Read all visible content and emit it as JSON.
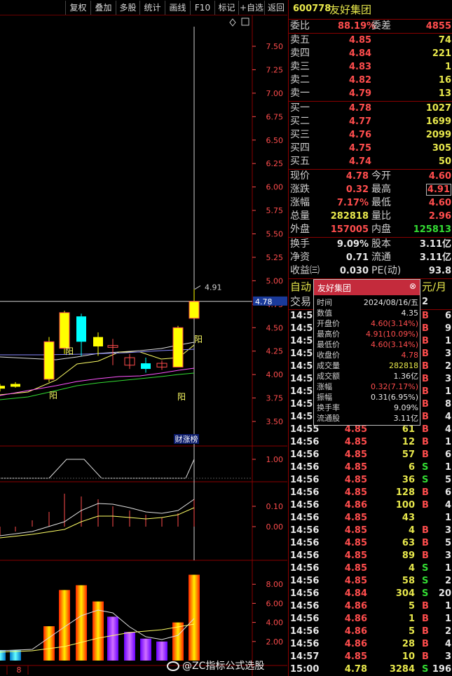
{
  "toolbar": {
    "items": [
      "复权",
      "叠加",
      "多股",
      "统计",
      "画线",
      "F10",
      "标记",
      "+自选",
      "返回"
    ]
  },
  "chart": {
    "price_axis": [
      "7.50",
      "7.25",
      "7.00",
      "6.75",
      "6.50",
      "6.25",
      "6.00",
      "5.75",
      "5.50",
      "5.25",
      "5.00",
      "4.75",
      "4.50",
      "4.25",
      "4.00",
      "3.75",
      "3.50"
    ],
    "current_price_tag": "4.78",
    "peak_label": "4.91",
    "yang_labels": [
      "阳",
      "阳",
      "阳",
      "阳"
    ],
    "event_label": "财涨榜",
    "ind1_axis": [
      "1.00"
    ],
    "ind2_axis": [
      "0.10",
      "0.00"
    ],
    "vol_axis": [
      "8.00",
      "6.00",
      "4.00",
      "2.00"
    ],
    "bottom_label": "8",
    "colors": {
      "up": "#ffff00",
      "down": "#00ffff",
      "red": "#ff3333",
      "purple": "#8a2be2",
      "axis": "#ff4d4d"
    },
    "chart_data": {
      "type": "candlestick",
      "candles": [
        {
          "o": 3.85,
          "c": 3.88,
          "h": 3.9,
          "l": 3.82
        },
        {
          "o": 3.87,
          "c": 3.9,
          "h": 3.92,
          "l": 3.86
        },
        {
          "o": 3.95,
          "c": 4.35,
          "h": 4.4,
          "l": 3.92
        },
        {
          "o": 4.28,
          "c": 4.66,
          "h": 4.68,
          "l": 4.22
        },
        {
          "o": 4.62,
          "c": 4.35,
          "h": 4.65,
          "l": 4.2
        },
        {
          "o": 4.3,
          "c": 4.4,
          "h": 4.45,
          "l": 4.2
        },
        {
          "o": 4.31,
          "c": 4.29,
          "h": 4.38,
          "l": 4.1
        },
        {
          "o": 4.18,
          "c": 4.1,
          "h": 4.22,
          "l": 4.06
        },
        {
          "o": 4.12,
          "c": 4.06,
          "h": 4.18,
          "l": 4.02
        },
        {
          "o": 4.12,
          "c": 4.08,
          "h": 4.15,
          "l": 4.05
        },
        {
          "o": 4.08,
          "c": 4.5,
          "h": 4.52,
          "l": 4.08
        },
        {
          "o": 4.6,
          "c": 4.78,
          "h": 4.91,
          "l": 4.6
        }
      ],
      "volume": [
        1.1,
        1.1,
        3.6,
        7.4,
        7.9,
        6.2,
        4.6,
        3.0,
        2.3,
        2.0,
        4.0,
        9.0
      ],
      "vol_ylim": [
        0,
        10
      ],
      "price_ylim": [
        3.4,
        7.7
      ]
    }
  },
  "quote": {
    "code": "600778",
    "name": "友好集团",
    "weibi_label": "委比",
    "weibi_value": "88.19%",
    "weicha_label": "委差",
    "weicha_value": "4855",
    "asks": [
      {
        "label": "卖五",
        "price": "4.85",
        "vol": "74"
      },
      {
        "label": "卖四",
        "price": "4.84",
        "vol": "221"
      },
      {
        "label": "卖三",
        "price": "4.83",
        "vol": "1"
      },
      {
        "label": "卖二",
        "price": "4.82",
        "vol": "16"
      },
      {
        "label": "卖一",
        "price": "4.79",
        "vol": "13"
      }
    ],
    "bids": [
      {
        "label": "买一",
        "price": "4.78",
        "vol": "1027"
      },
      {
        "label": "买二",
        "price": "4.77",
        "vol": "1699"
      },
      {
        "label": "买三",
        "price": "4.76",
        "vol": "2099"
      },
      {
        "label": "买四",
        "price": "4.75",
        "vol": "305"
      },
      {
        "label": "买五",
        "price": "4.74",
        "vol": "50"
      }
    ],
    "stats": [
      {
        "l1": "现价",
        "v1": "4.78",
        "c1": "red",
        "l2": "今开",
        "v2": "4.60",
        "c2": "red"
      },
      {
        "l1": "涨跌",
        "v1": "0.32",
        "c1": "red",
        "l2": "最高",
        "v2": "4.91",
        "c2": "red"
      },
      {
        "l1": "涨幅",
        "v1": "7.17%",
        "c1": "red",
        "l2": "最低",
        "v2": "4.60",
        "c2": "red"
      },
      {
        "l1": "总量",
        "v1": "282818",
        "c1": "yellow",
        "l2": "量比",
        "v2": "2.96",
        "c2": "red"
      },
      {
        "l1": "外盘",
        "v1": "157005",
        "c1": "red",
        "l2": "内盘",
        "v2": "125813",
        "c2": "green"
      }
    ],
    "stats2": [
      {
        "l1": "换手",
        "v1": "9.09%",
        "l2": "股本",
        "v2": "3.11亿"
      },
      {
        "l1": "净资",
        "v1": "0.71",
        "l2": "流通",
        "v2": "3.11亿"
      },
      {
        "l1": "收益㈢",
        "v1": "0.030",
        "l2": "PE(动)",
        "v2": "93.8"
      }
    ],
    "auto_label": "自动",
    "auto_tail": "元/月",
    "trade_label": "交易",
    "trade_tail": "2"
  },
  "ticks": [
    {
      "t": "14:55",
      "p": "",
      "v": "",
      "s": "B",
      "n": "6"
    },
    {
      "t": "14:55",
      "p": "",
      "v": "",
      "s": "B",
      "n": "9"
    },
    {
      "t": "14:55",
      "p": "",
      "v": "",
      "s": "B",
      "n": "1"
    },
    {
      "t": "14:55",
      "p": "",
      "v": "",
      "s": "B",
      "n": "3"
    },
    {
      "t": "14:55",
      "p": "",
      "v": "",
      "s": "B",
      "n": "2"
    },
    {
      "t": "14:55",
      "p": "",
      "v": "",
      "s": "B",
      "n": "3"
    },
    {
      "t": "14:55",
      "p": "",
      "v": "",
      "s": "B",
      "n": "1"
    },
    {
      "t": "14:55",
      "p": "",
      "v": "",
      "s": "B",
      "n": "8"
    },
    {
      "t": "14:55",
      "p": "",
      "v": "",
      "s": "B",
      "n": "4"
    },
    {
      "t": "14:55",
      "p": "4.85",
      "v": "61",
      "s": "B",
      "n": "4"
    },
    {
      "t": "14:56",
      "p": "4.85",
      "v": "12",
      "s": "B",
      "n": "1"
    },
    {
      "t": "14:56",
      "p": "4.85",
      "v": "57",
      "s": "B",
      "n": "6"
    },
    {
      "t": "14:56",
      "p": "4.85",
      "v": "6",
      "s": "S",
      "n": "1"
    },
    {
      "t": "14:56",
      "p": "4.85",
      "v": "36",
      "s": "S",
      "n": "5"
    },
    {
      "t": "14:56",
      "p": "4.85",
      "v": "128",
      "s": "B",
      "n": "6"
    },
    {
      "t": "14:56",
      "p": "4.86",
      "v": "100",
      "s": "B",
      "n": "4"
    },
    {
      "t": "14:56",
      "p": "4.85",
      "v": "43",
      "s": "",
      "n": "1"
    },
    {
      "t": "14:56",
      "p": "4.85",
      "v": "4",
      "s": "B",
      "n": "3"
    },
    {
      "t": "14:56",
      "p": "4.85",
      "v": "63",
      "s": "B",
      "n": "5"
    },
    {
      "t": "14:56",
      "p": "4.85",
      "v": "89",
      "s": "B",
      "n": "3"
    },
    {
      "t": "14:56",
      "p": "4.85",
      "v": "4",
      "s": "S",
      "n": "1"
    },
    {
      "t": "14:56",
      "p": "4.85",
      "v": "58",
      "s": "S",
      "n": "2"
    },
    {
      "t": "14:56",
      "p": "4.84",
      "v": "304",
      "s": "S",
      "n": "20"
    },
    {
      "t": "14:56",
      "p": "4.86",
      "v": "5",
      "s": "B",
      "n": "1"
    },
    {
      "t": "14:56",
      "p": "4.86",
      "v": "1",
      "s": "B",
      "n": "1"
    },
    {
      "t": "14:56",
      "p": "4.86",
      "v": "5",
      "s": "B",
      "n": "2"
    },
    {
      "t": "14:56",
      "p": "4.86",
      "v": "28",
      "s": "B",
      "n": "4"
    },
    {
      "t": "14:57",
      "p": "4.85",
      "v": "10",
      "s": "B",
      "n": "3"
    },
    {
      "t": "15:00",
      "p": "4.78",
      "v": "3284",
      "s": "S",
      "n": "196"
    }
  ],
  "popup": {
    "title": "友好集团",
    "close": "⊗",
    "rows": [
      {
        "label": "时间",
        "value": "2024/08/16/五",
        "color": "white"
      },
      {
        "label": "数值",
        "value": "4.35",
        "color": "white"
      },
      {
        "label": "开盘价",
        "value": "4.60(3.14%)",
        "color": "red"
      },
      {
        "label": "最高价",
        "value": "4.91(10.09%)",
        "color": "red"
      },
      {
        "label": "最低价",
        "value": "4.60(3.14%)",
        "color": "red"
      },
      {
        "label": "收盘价",
        "value": "4.78",
        "color": "red"
      },
      {
        "label": "成交量",
        "value": "282818",
        "color": "yellow"
      },
      {
        "label": "成交额",
        "value": "1.36亿",
        "color": "white"
      },
      {
        "label": "涨幅",
        "value": "0.32(7.17%)",
        "color": "red"
      },
      {
        "label": "振幅",
        "value": "0.31(6.95%)",
        "color": "white"
      },
      {
        "label": "换手率",
        "value": "9.09%",
        "color": "white"
      },
      {
        "label": "流通股",
        "value": "3.11亿",
        "color": "white"
      }
    ]
  },
  "watermark": "@ZC指标公式选股"
}
